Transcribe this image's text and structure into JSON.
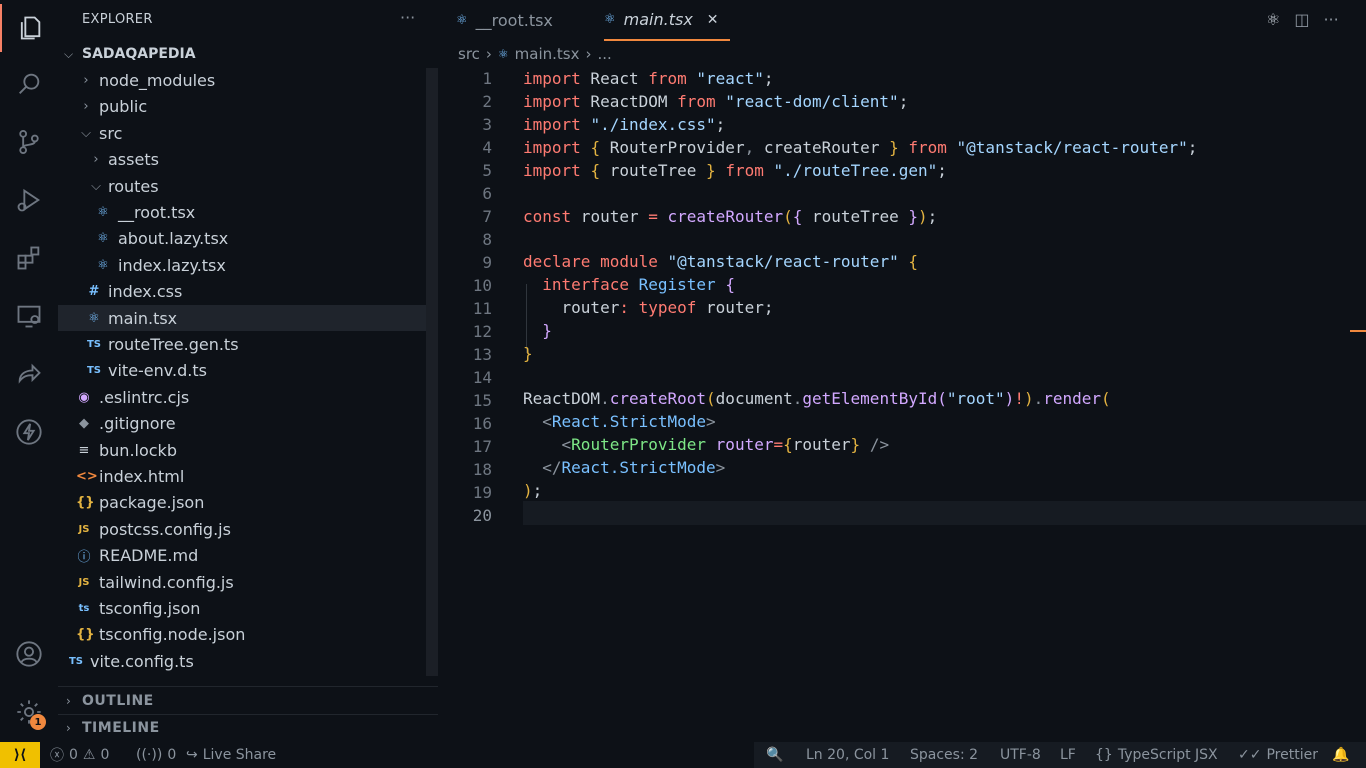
{
  "sidebar": {
    "title": "EXPLORER",
    "more": "···",
    "root": "SADAQAPEDIA",
    "items": [
      {
        "label": "node_modules",
        "icon": "chevron-right-icon"
      },
      {
        "label": "public",
        "icon": "chevron-right-icon"
      },
      {
        "label": "src",
        "icon": "chevron-down-icon"
      },
      {
        "label": "assets",
        "icon": "chevron-right-icon"
      },
      {
        "label": "routes",
        "icon": "chevron-down-icon"
      },
      {
        "label": "__root.tsx",
        "icon": "react-icon"
      },
      {
        "label": "about.lazy.tsx",
        "icon": "react-icon"
      },
      {
        "label": "index.lazy.tsx",
        "icon": "react-icon"
      },
      {
        "label": "index.css",
        "icon": "hash-icon"
      },
      {
        "label": "main.tsx",
        "icon": "react-icon"
      },
      {
        "label": "routeTree.gen.ts",
        "icon": "ts-icon"
      },
      {
        "label": "vite-env.d.ts",
        "icon": "ts-icon"
      },
      {
        "label": ".eslintrc.cjs",
        "icon": "eslint-icon"
      },
      {
        "label": ".gitignore",
        "icon": "git-icon"
      },
      {
        "label": "bun.lockb",
        "icon": "file-lines-icon"
      },
      {
        "label": "index.html",
        "icon": "html-icon"
      },
      {
        "label": "package.json",
        "icon": "json-icon"
      },
      {
        "label": "postcss.config.js",
        "icon": "js-icon"
      },
      {
        "label": "README.md",
        "icon": "info-icon"
      },
      {
        "label": "tailwind.config.js",
        "icon": "js-icon"
      },
      {
        "label": "tsconfig.json",
        "icon": "tsconfig-icon"
      },
      {
        "label": "tsconfig.node.json",
        "icon": "json-icon"
      },
      {
        "label": "vite.config.ts",
        "icon": "ts-icon"
      }
    ],
    "outline": "OUTLINE",
    "timeline": "TIMELINE"
  },
  "tabs": [
    {
      "label": "__root.tsx",
      "state": "inactive"
    },
    {
      "label": "main.tsx",
      "state": "active",
      "close": "✕"
    }
  ],
  "breadcrumb": {
    "folder": "src",
    "file": "main.tsx",
    "more": "..."
  },
  "editor": {
    "line_numbers": [
      "1",
      "2",
      "3",
      "4",
      "5",
      "6",
      "7",
      "8",
      "9",
      "10",
      "11",
      "12",
      "13",
      "14",
      "15",
      "16",
      "17",
      "18",
      "19",
      "20"
    ]
  },
  "activity": {
    "settings_badge": "1"
  },
  "status": {
    "remote": "⟩⟨",
    "errors": "0",
    "warnings": "0",
    "ports": "0",
    "live_share": "Live Share",
    "position": "Ln 20, Col 1",
    "spaces": "Spaces: 2",
    "encoding": "UTF-8",
    "eol": "LF",
    "language": "TypeScript JSX",
    "formatter": "Prettier"
  },
  "colors": {
    "accent": "#f0883e",
    "background": "#0d1117",
    "remote": "#f0c000"
  }
}
